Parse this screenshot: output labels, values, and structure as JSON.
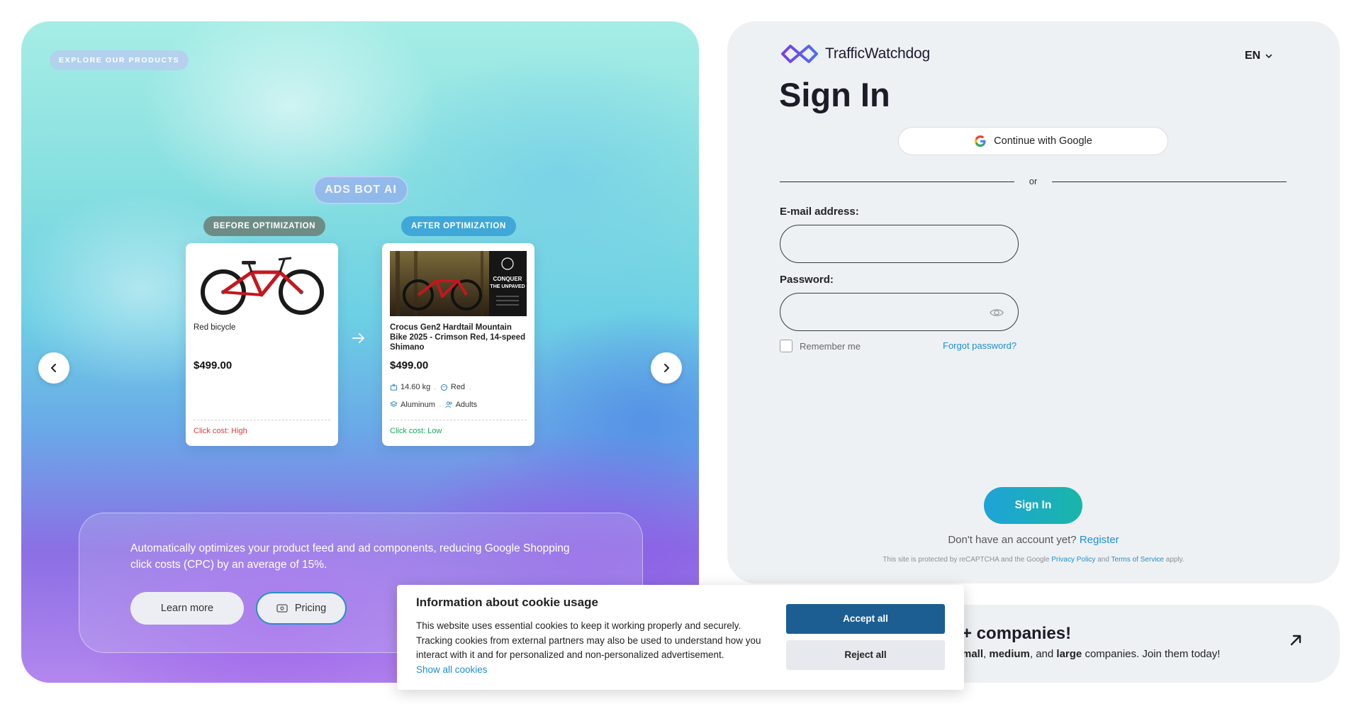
{
  "hero": {
    "tag": "EXPLORE OUR PRODUCTS",
    "ads_pill": "ADS BOT AI",
    "before_badge": "BEFORE OPTIMIZATION",
    "after_badge": "AFTER OPTIMIZATION",
    "before_card": {
      "name": "Red bicycle",
      "price": "$499.00",
      "cost": "Click cost: High"
    },
    "after_card": {
      "name": "Crocus Gen2 Hardtail Mountain Bike 2025 - Crimson Red, 14-speed Shimano",
      "price": "$499.00",
      "specs": {
        "weight": "14.60 kg",
        "color": "Red",
        "material": "Aluminum",
        "audience": "Adults"
      },
      "cost": "Click cost: Low",
      "image_text": "CONQUER THE UNPAVED"
    },
    "description": "Automatically optimizes your product feed and ad components, reducing Google Shopping click costs (CPC) by an average of 15%.",
    "learn_more": "Learn more",
    "pricing": "Pricing"
  },
  "signin": {
    "logo": "TrafficWatchdog",
    "lang": "EN",
    "title": "Sign In",
    "google": "Continue with Google",
    "or": "or",
    "email_label": "E-mail address:",
    "password_label": "Password:",
    "remember": "Remember me",
    "forgot": "Forgot password?",
    "submit": "Sign In",
    "no_account": "Don't have an account yet?",
    "register": "Register",
    "recaptcha_prefix": "This site is protected by reCAPTCHA and the Google",
    "privacy": "Privacy Policy",
    "and": "and",
    "terms": "Terms of Service",
    "apply": "apply."
  },
  "companies": {
    "title": "+ companies!",
    "desc_1": "mall",
    "desc_2": ",",
    "desc_3": "medium",
    "desc_4": ", and",
    "desc_5": "large",
    "desc_6": "companies. Join them today!"
  },
  "cookie": {
    "title": "Information about cookie usage",
    "body": "This website uses essential cookies to keep it working properly and securely. Tracking cookies from external partners may also be used to understand how you interact with it and for personalized and non-personalized advertisement.",
    "show_all": "Show all cookies",
    "accept": "Accept all",
    "reject": "Reject all"
  },
  "colors": {
    "accent": "#1e8fd0",
    "cost_high": "#e03a3a",
    "cost_low": "#17a85b",
    "cookie_accept": "#1c5e92"
  }
}
